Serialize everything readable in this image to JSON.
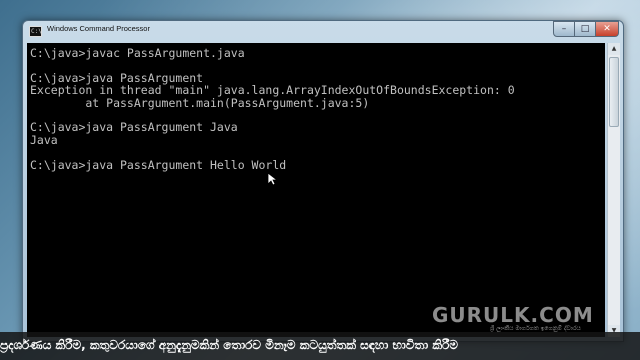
{
  "window": {
    "title": "Windows Command Processor",
    "title_icon_text": "C:\\",
    "controls": {
      "minimize": "–",
      "maximize": "□",
      "close": "✕"
    }
  },
  "console": {
    "text": "C:\\java>javac PassArgument.java\n\nC:\\java>java PassArgument\nException in thread \"main\" java.lang.ArrayIndexOutOfBoundsException: 0\n        at PassArgument.main(PassArgument.java:5)\n\nC:\\java>java PassArgument Java\nJava\n\nC:\\java>java PassArgument Hello World"
  },
  "scrollbar": {
    "up_glyph": "▲",
    "down_glyph": "▼"
  },
  "watermark": {
    "brand": "GURULK.COM",
    "tagline": "ශ්‍රී ලාංකීය මාර්ගගත ඉගෙනුම් ද්වාරය"
  },
  "subtitle": {
    "text": "ප්‍රදර්ශණය කිරීම, කතුවරයාගේ අනුදැනුමකින් තොරව මිනෑම කටයුත්තක් සඳහා භාවිතා කිරීම"
  }
}
